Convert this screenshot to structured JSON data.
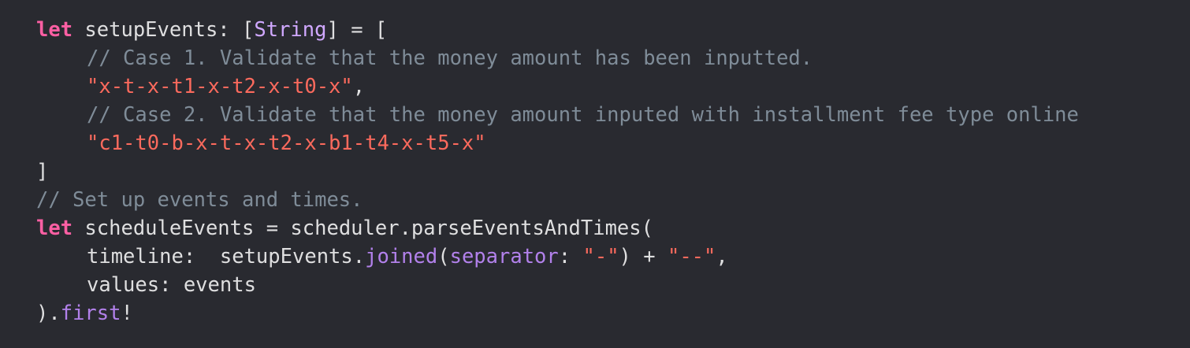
{
  "code": {
    "line1": {
      "kw": "let",
      "part1": " setupEvents: [",
      "type": "String",
      "part2": "] = ["
    },
    "line2": {
      "comment": "// Case 1. Validate that the money amount has been inputted."
    },
    "line3": {
      "string": "\"x-t-x-t1-x-t2-x-t0-x\"",
      "part": ","
    },
    "line4": {
      "comment": "// Case 2. Validate that the money amount inputed with installment fee type online"
    },
    "line5": {
      "string": "\"c1-t0-b-x-t-x-t2-x-b1-t4-x-t5-x\""
    },
    "line6": {
      "text": "]"
    },
    "line7": {
      "comment": "// Set up events and times."
    },
    "line8": {
      "kw": "let",
      "part": " scheduleEvents = scheduler.parseEventsAndTimes("
    },
    "line9": {
      "part1": "timeline:  setupEvents.",
      "fn": "joined",
      "part2": "(",
      "arg": "separator",
      "part3": ": ",
      "str1": "\"-\"",
      "part4": ") + ",
      "str2": "\"--\"",
      "part5": ","
    },
    "line10": {
      "text": "values: events"
    },
    "line11": {
      "part1": ").",
      "fn": "first",
      "part2": "!"
    }
  },
  "colors": {
    "background": "#292a30",
    "keyword": "#fc5fa3",
    "type": "#d0a8ff",
    "comment": "#7f8c98",
    "string": "#fc6a5d",
    "function": "#b281eb",
    "plain": "#dfdfe0"
  }
}
